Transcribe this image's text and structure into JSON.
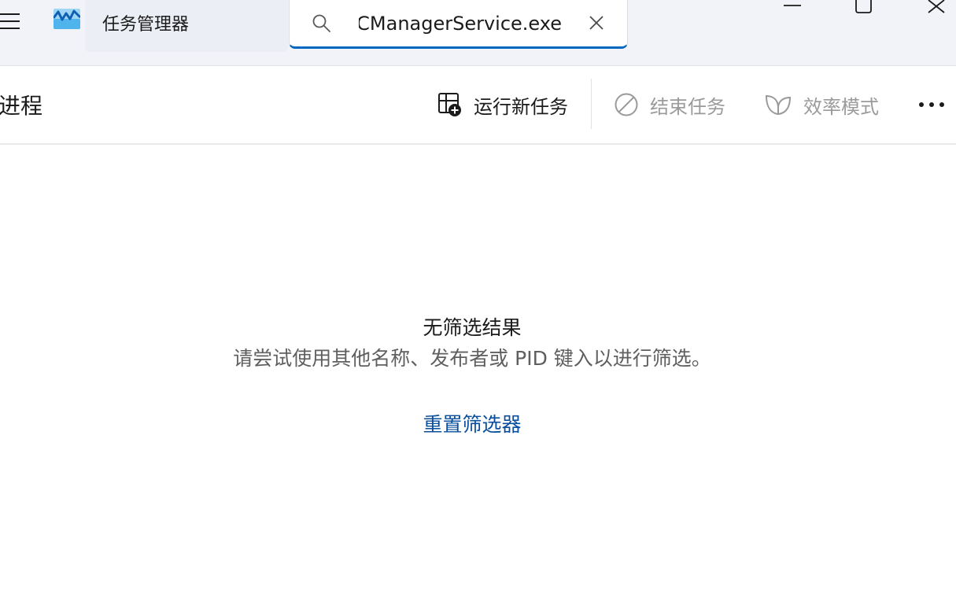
{
  "app": {
    "title": "任务管理器",
    "icon": "task-manager-logo"
  },
  "search": {
    "value": "CManagerService.exe"
  },
  "window_controls": {
    "minimize_icon": "minimize-icon",
    "maximize_icon": "maximize-icon",
    "close_icon": "close-icon"
  },
  "page": {
    "title": "进程"
  },
  "commands": {
    "run_new_task": "运行新任务",
    "end_task": "结束任务",
    "efficiency_mode": "效率模式",
    "more_icon": "more-horizontal-icon"
  },
  "empty_state": {
    "title": "无筛选结果",
    "hint": "请尝试使用其他名称、发布者或 PID 键入以进行筛选。",
    "reset_link": "重置筛选器"
  },
  "colors": {
    "accent": "#0067c0",
    "link": "#0a4f9e",
    "titlebar_bg": "#f1f3f8",
    "disabled_text": "#9a9a9a"
  }
}
